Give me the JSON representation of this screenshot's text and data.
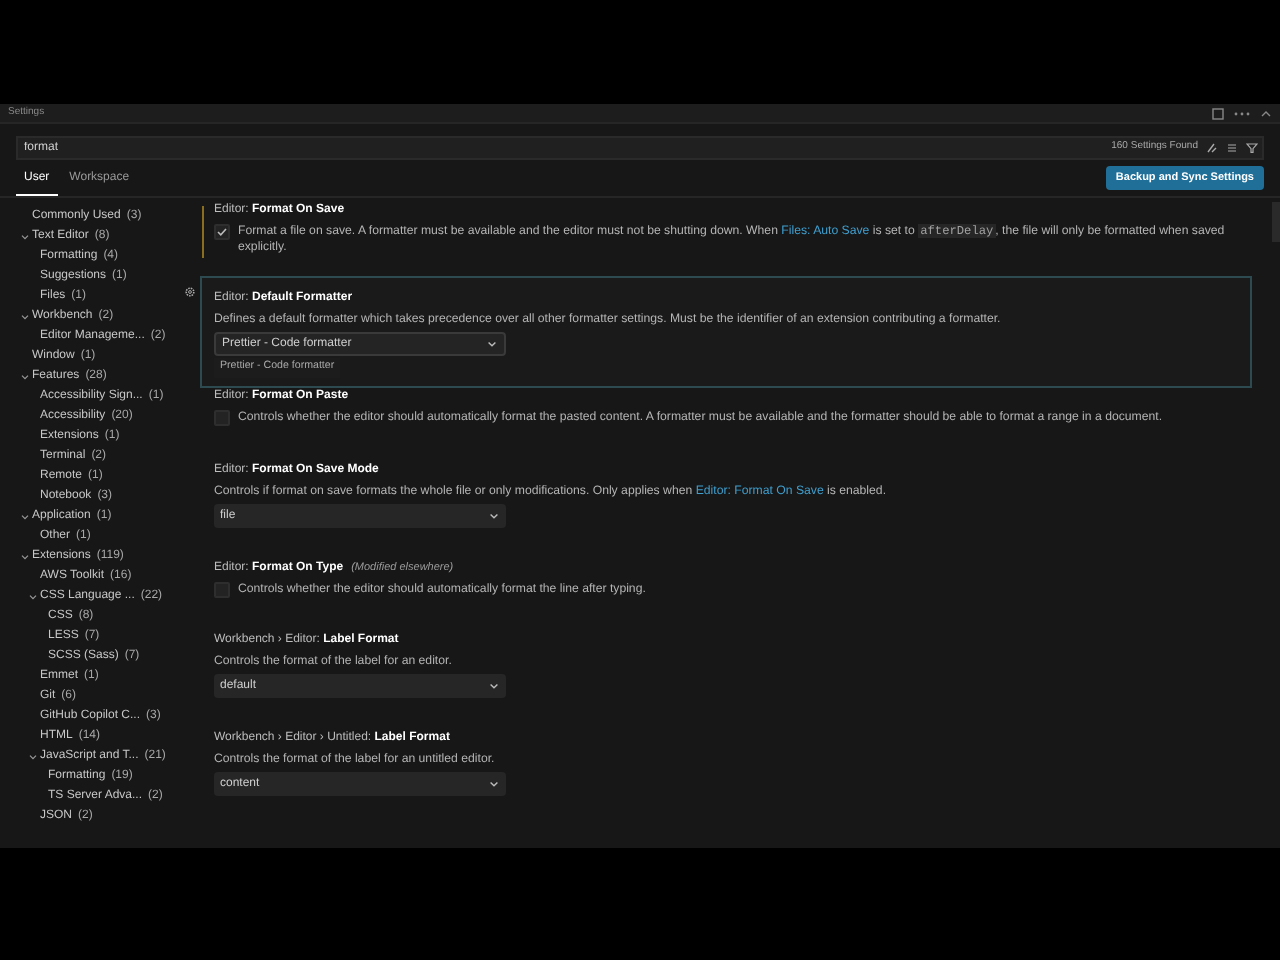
{
  "window": {
    "title": "Settings"
  },
  "search": {
    "value": "format",
    "result_count": "160 Settings Found"
  },
  "tabs": [
    {
      "label": "User",
      "selected": true
    },
    {
      "label": "Workspace",
      "selected": false
    }
  ],
  "sync_button": "Backup and Sync Settings",
  "tree": [
    {
      "label": "Commonly Used",
      "count": "(3)"
    },
    {
      "label": "Text Editor",
      "count": "(8)",
      "expanded": true,
      "children": [
        {
          "label": "Formatting",
          "count": "(4)"
        },
        {
          "label": "Suggestions",
          "count": "(1)"
        },
        {
          "label": "Files",
          "count": "(1)"
        }
      ]
    },
    {
      "label": "Workbench",
      "count": "(2)",
      "expanded": true,
      "children": [
        {
          "label": "Editor Manageme...",
          "count": "(2)"
        }
      ]
    },
    {
      "label": "Window",
      "count": "(1)"
    },
    {
      "label": "Features",
      "count": "(28)",
      "expanded": true,
      "children": [
        {
          "label": "Accessibility Sign...",
          "count": "(1)"
        },
        {
          "label": "Accessibility",
          "count": "(20)"
        },
        {
          "label": "Extensions",
          "count": "(1)"
        },
        {
          "label": "Terminal",
          "count": "(2)"
        },
        {
          "label": "Remote",
          "count": "(1)"
        },
        {
          "label": "Notebook",
          "count": "(3)"
        }
      ]
    },
    {
      "label": "Application",
      "count": "(1)",
      "expanded": true,
      "children": [
        {
          "label": "Other",
          "count": "(1)"
        }
      ]
    },
    {
      "label": "Extensions",
      "count": "(119)",
      "expanded": true,
      "children": [
        {
          "label": "AWS Toolkit",
          "count": "(16)"
        },
        {
          "label": "CSS Language ...",
          "count": "(22)",
          "expanded": true,
          "children": [
            {
              "label": "CSS",
              "count": "(8)"
            },
            {
              "label": "LESS",
              "count": "(7)"
            },
            {
              "label": "SCSS (Sass)",
              "count": "(7)"
            }
          ]
        },
        {
          "label": "Emmet",
          "count": "(1)"
        },
        {
          "label": "Git",
          "count": "(6)"
        },
        {
          "label": "GitHub Copilot C...",
          "count": "(3)"
        },
        {
          "label": "HTML",
          "count": "(14)"
        },
        {
          "label": "JavaScript and T...",
          "count": "(21)",
          "expanded": true,
          "children": [
            {
              "label": "Formatting",
              "count": "(19)"
            },
            {
              "label": "TS Server Adva...",
              "count": "(2)"
            }
          ]
        },
        {
          "label": "JSON",
          "count": "(2)"
        }
      ]
    }
  ],
  "settings": [
    {
      "kind": "checkbox",
      "category": "Editor: ",
      "name": "Format On Save",
      "modified": true,
      "checked": true,
      "description": [
        {
          "kind": "text",
          "text": "Format a file on save. A formatter must be available and the editor must not be shutting down. When "
        },
        {
          "kind": "link",
          "text": "Files: Auto Save"
        },
        {
          "kind": "text",
          "text": " is set to "
        },
        {
          "kind": "code",
          "text": "afterDelay"
        },
        {
          "kind": "text",
          "text": ", the file will only be formatted when saved explicitly."
        }
      ]
    },
    {
      "kind": "select",
      "category": "Editor: ",
      "name": "Default Formatter",
      "focused": true,
      "value": "Prettier - Code formatter",
      "hint": "Prettier - Code formatter",
      "description": [
        {
          "kind": "text",
          "text": "Defines a default formatter which takes precedence over all other formatter settings. Must be the identifier of an extension contributing a formatter."
        }
      ]
    },
    {
      "kind": "checkbox",
      "category": "Editor: ",
      "name": "Format On Paste",
      "checked": false,
      "description": [
        {
          "kind": "text",
          "text": "Controls whether the editor should automatically format the pasted content. A formatter must be available and the formatter should be able to format a range in a document."
        }
      ]
    },
    {
      "kind": "select",
      "category": "Editor: ",
      "name": "Format On Save Mode",
      "value": "file",
      "description": [
        {
          "kind": "text",
          "text": "Controls if format on save formats the whole file or only modifications. Only applies when "
        },
        {
          "kind": "link",
          "text": "Editor: Format On Save"
        },
        {
          "kind": "text",
          "text": " is enabled."
        }
      ]
    },
    {
      "kind": "checkbox",
      "category": "Editor: ",
      "name": "Format On Type",
      "note": "(Modified elsewhere)",
      "checked": false,
      "description": [
        {
          "kind": "text",
          "text": "Controls whether the editor should automatically format the line after typing."
        }
      ]
    },
    {
      "kind": "select",
      "category": "Workbench › Editor: ",
      "name": "Label Format",
      "value": "default",
      "description": [
        {
          "kind": "text",
          "text": "Controls the format of the label for an editor."
        }
      ]
    },
    {
      "kind": "select",
      "category": "Workbench › Editor › Untitled: ",
      "name": "Label Format",
      "value": "content",
      "description": [
        {
          "kind": "text",
          "text": "Controls the format of the label for an untitled editor."
        }
      ]
    }
  ]
}
